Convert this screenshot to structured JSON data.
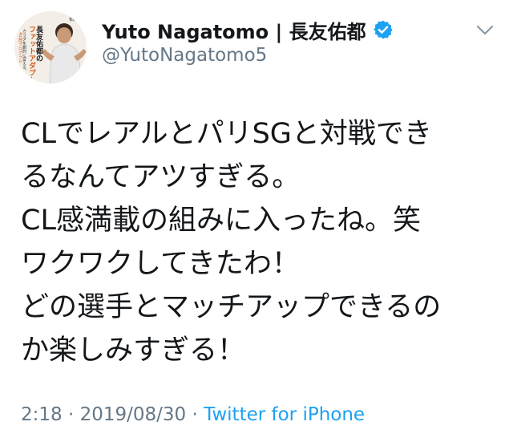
{
  "user": {
    "display_name": "Yuto Nagatomo | 長友佑都",
    "handle": "@YutoNagatomo5",
    "verified_icon": "verified-badge-icon",
    "avatar": {
      "title_lines": [
        "長友佑都の",
        "ファットアダプト"
      ],
      "subtitle_lines": [
        "カラダを劇的に変える、",
        "4日間プログラム"
      ],
      "sign": "佑都"
    }
  },
  "menu_icon": "chevron-down-icon",
  "tweet": {
    "lines": [
      "CLでレアルとパリSGと対戦でき",
      "るなんてアツすぎる。",
      "CL感満載の組みに入ったね。笑",
      "ワクワクしてきたわ！",
      "どの選手とマッチアップできるの",
      "か楽しみすぎる！"
    ],
    "time": "2:18",
    "date": "2019/08/30",
    "source": "Twitter for iPhone",
    "separator": "·"
  },
  "colors": {
    "text": "#14171a",
    "secondary": "#657786",
    "link": "#1da1f2"
  }
}
